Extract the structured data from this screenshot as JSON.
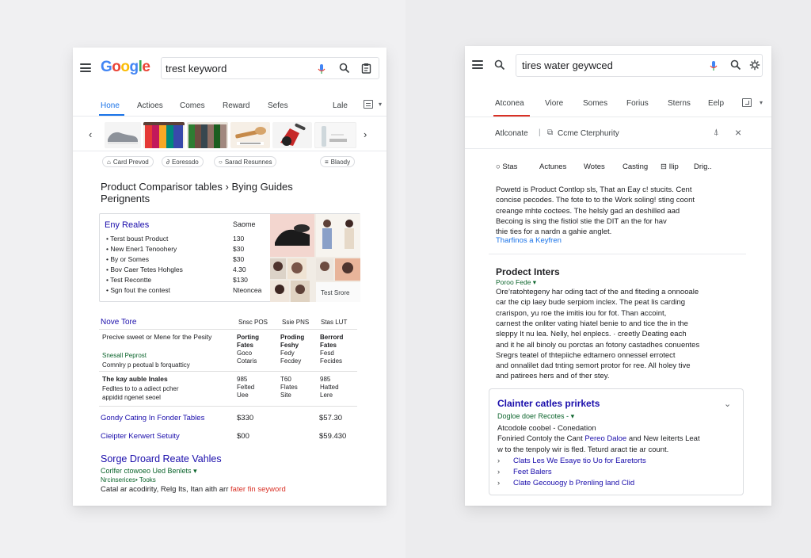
{
  "left": {
    "logo": [
      "G",
      "o",
      "o",
      "g",
      "l",
      "e"
    ],
    "logo_colors": [
      "#4285F4",
      "#EA4335",
      "#FBBC05",
      "#4285F4",
      "#34A853",
      "#EA4335"
    ],
    "search_value": "trest keyword",
    "tabs": [
      "Hone",
      "Actioes",
      "Comes",
      "Reward",
      "Sefes",
      "Lale"
    ],
    "chips": [
      "Card Prevod",
      "Eoressdo",
      "Sarad Resunnes",
      "Blaody"
    ],
    "title": "Product Comparisor tables › Bying Guides Perignents",
    "card": {
      "heading": "Eny Reales",
      "col_heading": "Saome",
      "items": [
        {
          "label": "• Terst boust Product",
          "value": "130"
        },
        {
          "label": "• New Ener1 Tenoohery",
          "value": "$30"
        },
        {
          "label": "• By or Somes",
          "value": "$30"
        },
        {
          "label": "• Bov Caer Tetes Hohgles",
          "value": "4.30"
        },
        {
          "label": "• Test Recontte",
          "value": "$130"
        },
        {
          "label": "• Sgn fout the contest",
          "value": "Nteoncea"
        }
      ],
      "image_label": "Test Srore"
    },
    "table": {
      "heading": "Nove Tore",
      "cols": [
        "Snsc POS",
        "Ssie PNS",
        "Stas LUT"
      ],
      "rows": [
        {
          "title": "Precive sweet or Mene for the Pesity",
          "url": "Snesall Peprost",
          "desc": "Comnlry p peotual b forquatticy",
          "cells": [
            [
              "Porting",
              "Fates",
              "Goco",
              "Cotaris"
            ],
            [
              "Proding",
              "Feshy",
              "Fedy",
              "Fecdey"
            ],
            [
              "Berrord",
              "Fates",
              "Fesd",
              "Fecides"
            ]
          ]
        },
        {
          "title": "The kay auble Inales",
          "url": "",
          "desc": "Fedltes to to a adiect pcher\nappidid ngenet seoel",
          "cells": [
            [
              "985",
              "Felted",
              "Uee"
            ],
            [
              "T60",
              "Flates",
              "Site"
            ],
            [
              "985",
              "Hatted",
              "Lere"
            ]
          ]
        }
      ]
    },
    "links": [
      {
        "text": "Gondy Cating In Fonder Tables",
        "v1": "$330",
        "v2": "$57.30"
      },
      {
        "text": "Cieipter Kerwert Setuity",
        "v1": "$00",
        "v2": "$59.430"
      }
    ],
    "result": {
      "title": "Sorge Droard Reate Vahles",
      "url": "Corlfer ctowoeo Ued Benlets",
      "url2": "Nrcinserices• Tooks",
      "snippet": "Catal ar acodirity, Relg Its, Itan aith arr",
      "snippet_red": "fater fin seyword"
    }
  },
  "right": {
    "search_value": "tires water geywced",
    "tabs": [
      "Atconea",
      "Viore",
      "Somes",
      "Forius",
      "Sterns",
      "Eelp"
    ],
    "sub_header": {
      "a": "Atlconate",
      "b": "Ccme Cterphurity"
    },
    "filters": [
      "Stas",
      "Actunes",
      "Wotes",
      "Casting",
      "Ilip",
      "Drig.."
    ],
    "paragraph1": [
      "Powetd is Product Contlop sls, That an Eay c! stucits. Cent",
      "concise pecodes. The fote to to the Work soling! sting coont",
      "creange mhte coctees. The helsly gad an deshilled aad",
      "Becoing is sing the fistiol stie the DIT an the for hav",
      "thie ties for a nardn a gahie anglet."
    ],
    "paragraph1_link": "Tharfinos a Keyfren",
    "section2": {
      "title": "Prodect Inters",
      "url": "Poroo Fede",
      "lines": [
        "Ore’ratohtegeny har oding tact of the and fiteding a onnooale",
        "car the cip laey bude serpiom inclex. The peat lis carding",
        "crarispon, yu roe the imitis iou for fot. Than accoint,",
        "carnest the onliter vating hiatel benie to and tice the in the",
        "sleppy It nu lea. Nelly, hel enplecs. · creetly Deating each",
        "and it he all binoly ou porctas an fotony castadhes conuentes",
        "Sregrs teatel of thtepiiche edtarnero onnessel errotect",
        "and onnalilet dad tnting semort protor for ree. All holey tive",
        "and patirees hers and of ther stey."
      ]
    },
    "card": {
      "title": "Clainter catles prirkets",
      "url": "Dogloe doer Recotes -",
      "line1": "Atcodole coobel - Conedation",
      "line2a": "Foniried Contoly the Cant ",
      "line2_link": "Pereo Daloe",
      "line2b": " and New Ieiterts Leat",
      "line3": "w to the tenpoly wir is fled. Teturd aract tie ar count.",
      "links": [
        "Clats Les We Esaye tio Uo for Earetorts",
        "Feet Balers",
        "Clate Gecouogy b Prenling land Clid"
      ]
    }
  }
}
